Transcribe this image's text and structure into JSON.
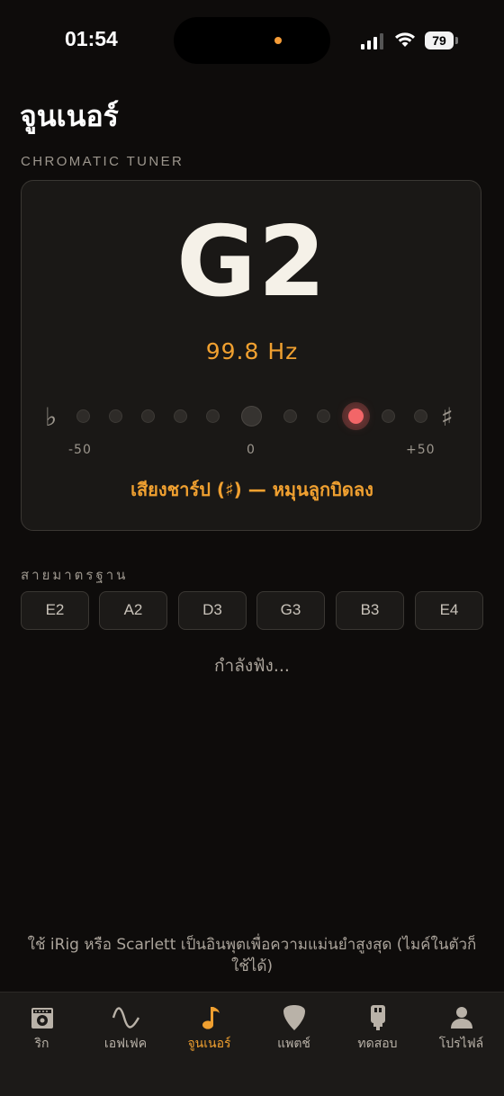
{
  "status_bar": {
    "time": "01:54",
    "battery": "79"
  },
  "page": {
    "title": "จูนเนอร์",
    "section_label": "CHROMATIC TUNER"
  },
  "tuner": {
    "note": "G2",
    "frequency": "99.8 Hz",
    "flat_symbol": "♭",
    "sharp_symbol": "♯",
    "scale_min": "-50",
    "scale_mid": "0",
    "scale_max": "+50",
    "hint": "เสียงชาร์ป (♯) — หมุนลูกบิดลง",
    "accent_color": "#f0a030",
    "indicator_color": "#f26668"
  },
  "standard": {
    "label": "สายมาตรฐาน",
    "strings": [
      "E2",
      "A2",
      "D3",
      "G3",
      "B3",
      "E4"
    ]
  },
  "listening": "กำลังฟัง...",
  "footer_note": "ใช้ iRig หรือ Scarlett เป็นอินพุตเพื่อความแม่นยำสูงสุด (ไมค์ในตัวก็ใช้ได้)",
  "tabs": [
    {
      "label": "ริก",
      "icon": "amp-icon"
    },
    {
      "label": "เอฟเฟค",
      "icon": "wave-icon"
    },
    {
      "label": "จูนเนอร์",
      "icon": "music-note-icon",
      "active": true
    },
    {
      "label": "แพตช์",
      "icon": "pick-icon"
    },
    {
      "label": "ทดสอบ",
      "icon": "usb-icon"
    },
    {
      "label": "โปรไฟล์",
      "icon": "profile-icon"
    }
  ]
}
